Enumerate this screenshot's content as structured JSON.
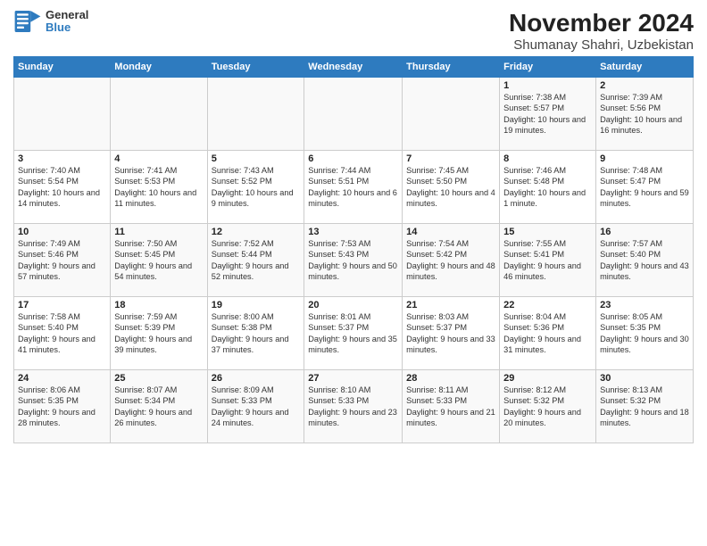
{
  "header": {
    "logo_line1": "General",
    "logo_line2": "Blue",
    "title": "November 2024",
    "subtitle": "Shumanay Shahri, Uzbekistan"
  },
  "weekdays": [
    "Sunday",
    "Monday",
    "Tuesday",
    "Wednesday",
    "Thursday",
    "Friday",
    "Saturday"
  ],
  "weeks": [
    [
      {
        "day": "",
        "info": ""
      },
      {
        "day": "",
        "info": ""
      },
      {
        "day": "",
        "info": ""
      },
      {
        "day": "",
        "info": ""
      },
      {
        "day": "",
        "info": ""
      },
      {
        "day": "1",
        "info": "Sunrise: 7:38 AM\nSunset: 5:57 PM\nDaylight: 10 hours and 19 minutes."
      },
      {
        "day": "2",
        "info": "Sunrise: 7:39 AM\nSunset: 5:56 PM\nDaylight: 10 hours and 16 minutes."
      }
    ],
    [
      {
        "day": "3",
        "info": "Sunrise: 7:40 AM\nSunset: 5:54 PM\nDaylight: 10 hours and 14 minutes."
      },
      {
        "day": "4",
        "info": "Sunrise: 7:41 AM\nSunset: 5:53 PM\nDaylight: 10 hours and 11 minutes."
      },
      {
        "day": "5",
        "info": "Sunrise: 7:43 AM\nSunset: 5:52 PM\nDaylight: 10 hours and 9 minutes."
      },
      {
        "day": "6",
        "info": "Sunrise: 7:44 AM\nSunset: 5:51 PM\nDaylight: 10 hours and 6 minutes."
      },
      {
        "day": "7",
        "info": "Sunrise: 7:45 AM\nSunset: 5:50 PM\nDaylight: 10 hours and 4 minutes."
      },
      {
        "day": "8",
        "info": "Sunrise: 7:46 AM\nSunset: 5:48 PM\nDaylight: 10 hours and 1 minute."
      },
      {
        "day": "9",
        "info": "Sunrise: 7:48 AM\nSunset: 5:47 PM\nDaylight: 9 hours and 59 minutes."
      }
    ],
    [
      {
        "day": "10",
        "info": "Sunrise: 7:49 AM\nSunset: 5:46 PM\nDaylight: 9 hours and 57 minutes."
      },
      {
        "day": "11",
        "info": "Sunrise: 7:50 AM\nSunset: 5:45 PM\nDaylight: 9 hours and 54 minutes."
      },
      {
        "day": "12",
        "info": "Sunrise: 7:52 AM\nSunset: 5:44 PM\nDaylight: 9 hours and 52 minutes."
      },
      {
        "day": "13",
        "info": "Sunrise: 7:53 AM\nSunset: 5:43 PM\nDaylight: 9 hours and 50 minutes."
      },
      {
        "day": "14",
        "info": "Sunrise: 7:54 AM\nSunset: 5:42 PM\nDaylight: 9 hours and 48 minutes."
      },
      {
        "day": "15",
        "info": "Sunrise: 7:55 AM\nSunset: 5:41 PM\nDaylight: 9 hours and 46 minutes."
      },
      {
        "day": "16",
        "info": "Sunrise: 7:57 AM\nSunset: 5:40 PM\nDaylight: 9 hours and 43 minutes."
      }
    ],
    [
      {
        "day": "17",
        "info": "Sunrise: 7:58 AM\nSunset: 5:40 PM\nDaylight: 9 hours and 41 minutes."
      },
      {
        "day": "18",
        "info": "Sunrise: 7:59 AM\nSunset: 5:39 PM\nDaylight: 9 hours and 39 minutes."
      },
      {
        "day": "19",
        "info": "Sunrise: 8:00 AM\nSunset: 5:38 PM\nDaylight: 9 hours and 37 minutes."
      },
      {
        "day": "20",
        "info": "Sunrise: 8:01 AM\nSunset: 5:37 PM\nDaylight: 9 hours and 35 minutes."
      },
      {
        "day": "21",
        "info": "Sunrise: 8:03 AM\nSunset: 5:37 PM\nDaylight: 9 hours and 33 minutes."
      },
      {
        "day": "22",
        "info": "Sunrise: 8:04 AM\nSunset: 5:36 PM\nDaylight: 9 hours and 31 minutes."
      },
      {
        "day": "23",
        "info": "Sunrise: 8:05 AM\nSunset: 5:35 PM\nDaylight: 9 hours and 30 minutes."
      }
    ],
    [
      {
        "day": "24",
        "info": "Sunrise: 8:06 AM\nSunset: 5:35 PM\nDaylight: 9 hours and 28 minutes."
      },
      {
        "day": "25",
        "info": "Sunrise: 8:07 AM\nSunset: 5:34 PM\nDaylight: 9 hours and 26 minutes."
      },
      {
        "day": "26",
        "info": "Sunrise: 8:09 AM\nSunset: 5:33 PM\nDaylight: 9 hours and 24 minutes."
      },
      {
        "day": "27",
        "info": "Sunrise: 8:10 AM\nSunset: 5:33 PM\nDaylight: 9 hours and 23 minutes."
      },
      {
        "day": "28",
        "info": "Sunrise: 8:11 AM\nSunset: 5:33 PM\nDaylight: 9 hours and 21 minutes."
      },
      {
        "day": "29",
        "info": "Sunrise: 8:12 AM\nSunset: 5:32 PM\nDaylight: 9 hours and 20 minutes."
      },
      {
        "day": "30",
        "info": "Sunrise: 8:13 AM\nSunset: 5:32 PM\nDaylight: 9 hours and 18 minutes."
      }
    ]
  ]
}
